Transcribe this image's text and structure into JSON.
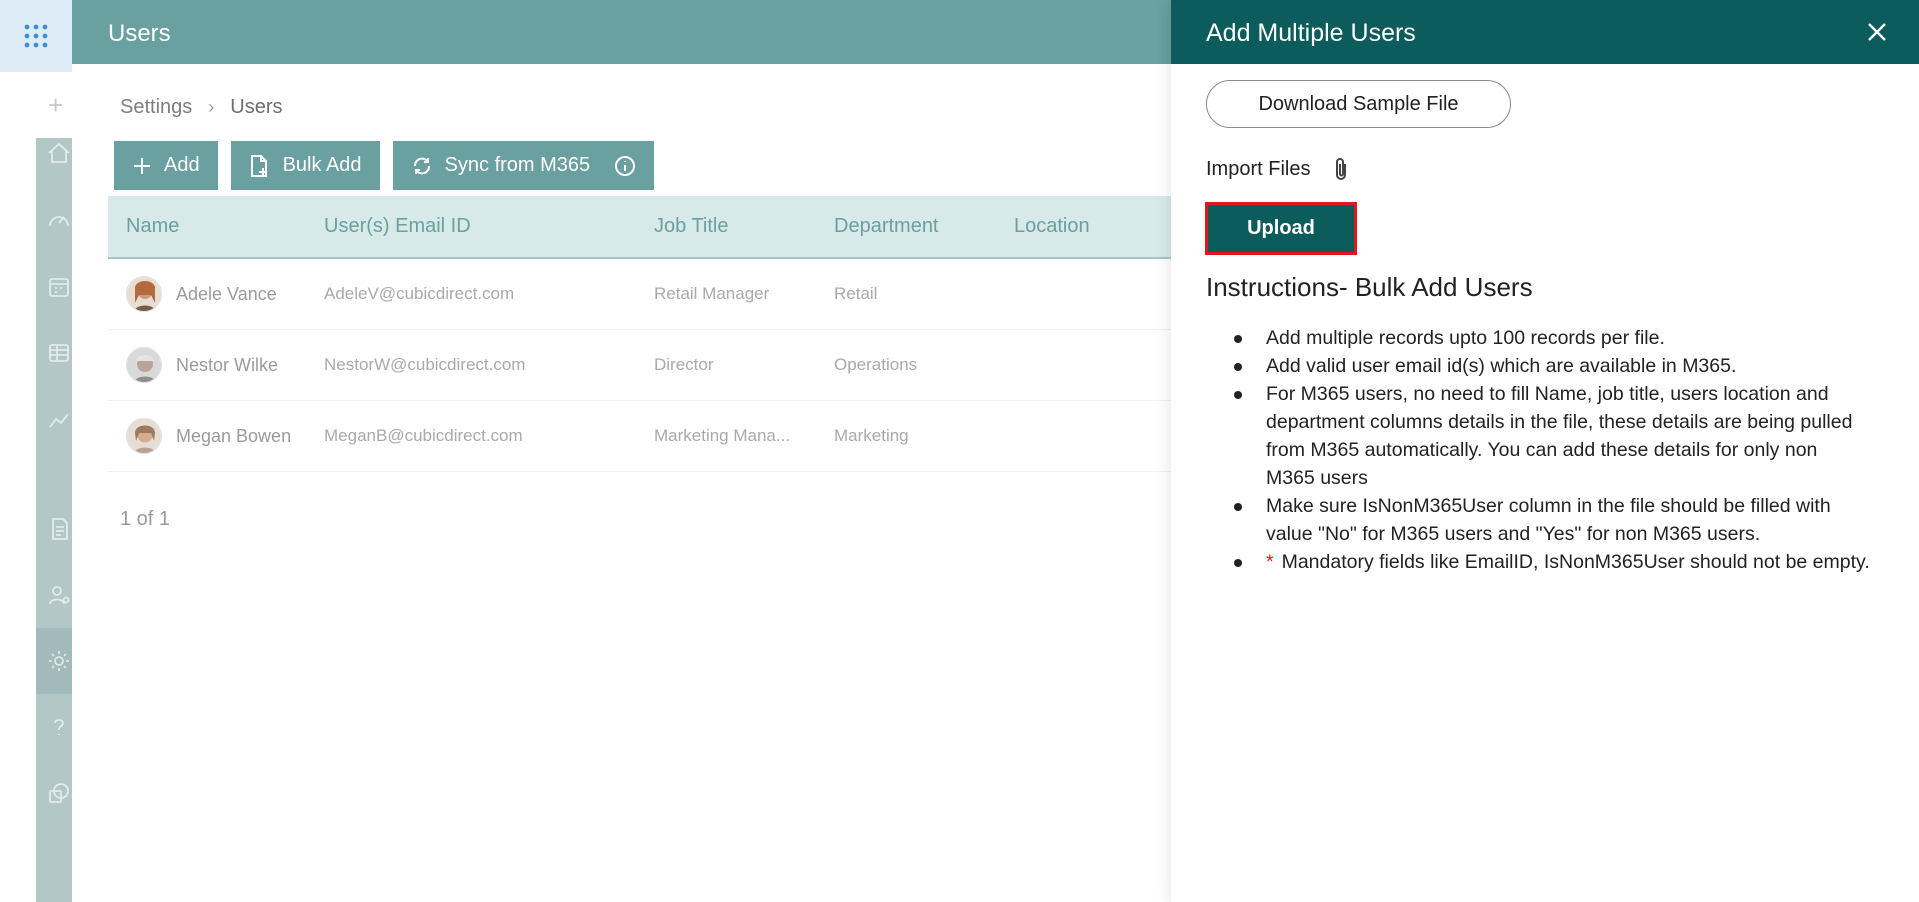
{
  "app": {
    "page_title": "Users"
  },
  "breadcrumb": {
    "items": [
      "Settings",
      "Users"
    ]
  },
  "toolbar": {
    "add_label": "Add",
    "bulk_add_label": "Bulk Add",
    "sync_label": "Sync from M365"
  },
  "table": {
    "columns": [
      "Name",
      "User(s) Email ID",
      "Job Title",
      "Department",
      "Location"
    ],
    "rows": [
      {
        "name": "Adele Vance",
        "email": "AdeleV@cubicdirect.com",
        "job_title": "Retail Manager",
        "department": "Retail",
        "location": ""
      },
      {
        "name": "Nestor Wilke",
        "email": "NestorW@cubicdirect.com",
        "job_title": "Director",
        "department": "Operations",
        "location": ""
      },
      {
        "name": "Megan Bowen",
        "email": "MeganB@cubicdirect.com",
        "job_title": "Marketing Mana...",
        "department": "Marketing",
        "location": ""
      }
    ]
  },
  "pagination": {
    "text": "1 of 1"
  },
  "panel": {
    "title": "Add Multiple Users",
    "download_sample_label": "Download Sample File",
    "import_files_label": "Import Files",
    "upload_label": "Upload",
    "instructions_title": "Instructions- Bulk Add Users",
    "instructions": [
      "Add multiple records upto 100 records per file.",
      "Add valid user email id(s) which are available in M365.",
      "For M365 users, no need to fill Name, job title, users location and department columns details in the file, these details are being pulled from M365 automatically. You can add these details for only non M365 users",
      "Make sure IsNonM365User column in the file should be filled with value \"No\" for M365 users and \"Yes\" for non M365 users."
    ],
    "required_marker": "*",
    "required_note": "Mandatory fields like EmailID, IsNonM365User should not be empty."
  },
  "colors": {
    "brand_teal": "#0b5c5b",
    "dimmed_teal": "#6aa09f",
    "highlight_red": "#e5161b"
  },
  "icons": {
    "rail": [
      "home-icon",
      "dashboard-icon",
      "calendar-icon",
      "table-icon",
      "chart-icon",
      "report-icon",
      "user-settings-icon",
      "gear-icon",
      "help-icon",
      "sharepoint-icon"
    ]
  }
}
